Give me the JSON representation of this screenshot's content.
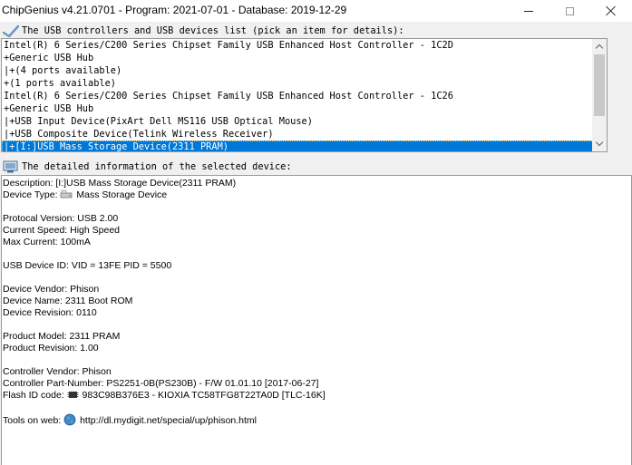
{
  "window": {
    "title": "ChipGenius v4.21.0701 - Program: 2021-07-01 - Database: 2019-12-29"
  },
  "device_list": {
    "header": "The USB controllers and USB devices list (pick an item for details):",
    "items": [
      "Intel(R) 6 Series/C200 Series Chipset Family USB Enhanced Host Controller - 1C2D",
      "+Generic USB Hub",
      "|+(4 ports available)",
      "+(1 ports available)",
      "Intel(R) 6 Series/C200 Series Chipset Family USB Enhanced Host Controller - 1C26",
      "+Generic USB Hub",
      "|+USB Input Device(PixArt Dell MS116 USB Optical Mouse)",
      "|+USB Composite Device(Telink Wireless Receiver)",
      "|+[I:]USB Mass Storage Device(2311 PRAM)"
    ],
    "selected_index": 8
  },
  "details": {
    "header": "The detailed information of the selected device:",
    "description": "Description: [I:]USB Mass Storage Device(2311 PRAM)",
    "device_type_label": "Device Type:",
    "device_type_value": "Mass Storage Device",
    "protocol_version": "Protocal Version: USB 2.00",
    "current_speed": "Current Speed: High Speed",
    "max_current": "Max Current: 100mA",
    "usb_device_id": "USB Device ID: VID = 13FE PID = 5500",
    "device_vendor": "Device Vendor: Phison",
    "device_name": "Device Name: 2311 Boot ROM",
    "device_revision": "Device Revision: 0110",
    "product_model": "Product Model: 2311 PRAM",
    "product_revision": "Product Revision: 1.00",
    "controller_vendor": "Controller Vendor: Phison",
    "controller_part_number": "Controller Part-Number: PS2251-0B(PS230B) - F/W 01.01.10 [2017-06-27]",
    "flash_id_label": "Flash ID code:",
    "flash_id_value": "983C98B376E3 - KIOXIA TC58TFG8T22TA0D [TLC-16K]",
    "tools_label": "Tools on web:",
    "tools_url": "http://dl.mydigit.net/special/up/phison.html"
  }
}
